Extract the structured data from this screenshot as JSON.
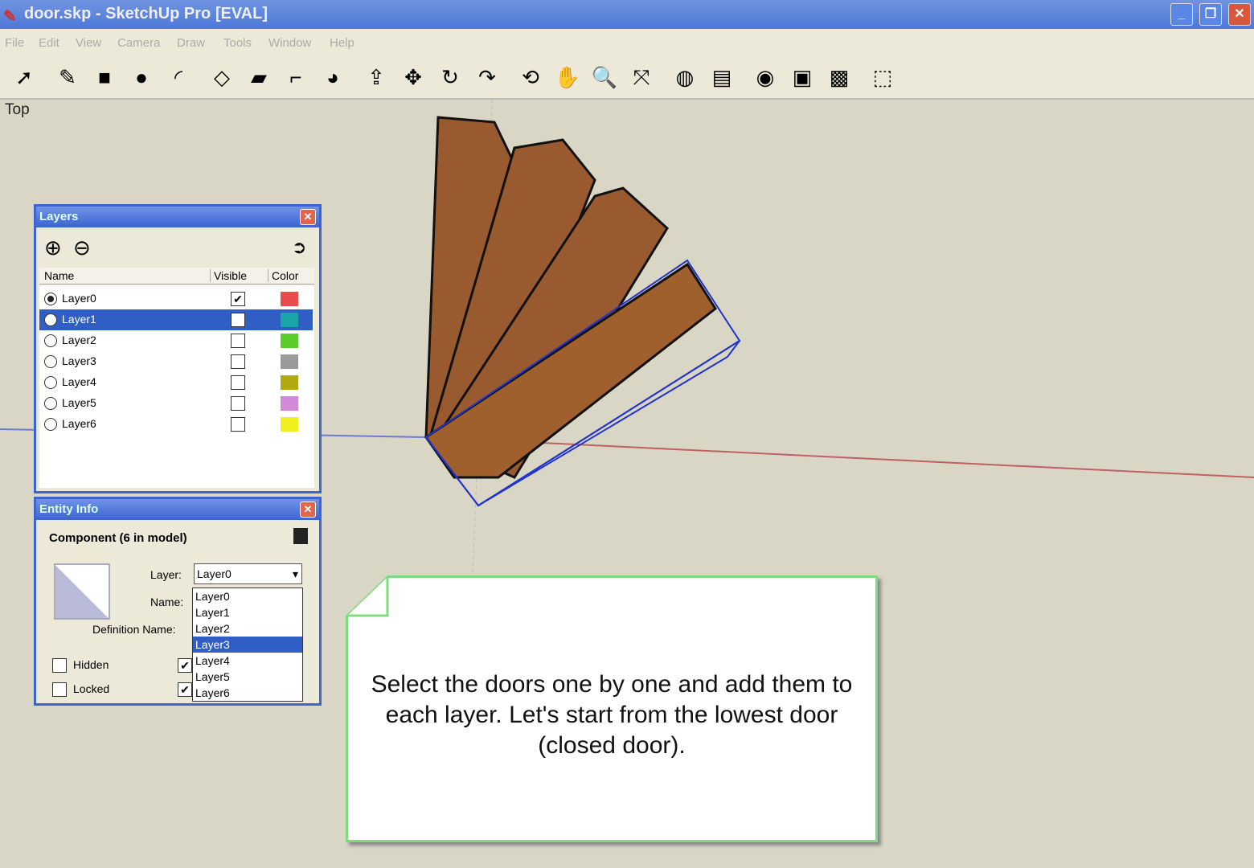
{
  "window": {
    "title": "door.skp - SketchUp Pro [EVAL]",
    "min": "_",
    "restore": "❐",
    "close": "✕"
  },
  "menu": [
    "File",
    "Edit",
    "View",
    "Camera",
    "Draw",
    "Tools",
    "Window",
    "Help"
  ],
  "toolbar": [
    {
      "name": "select",
      "g": "➚"
    },
    {
      "name": "pencil",
      "g": "✎"
    },
    {
      "name": "rectangle",
      "g": "■"
    },
    {
      "name": "circle",
      "g": "●"
    },
    {
      "name": "arc",
      "g": "◜"
    },
    {
      "name": "make-component",
      "g": "◇"
    },
    {
      "name": "eraser",
      "g": "▰"
    },
    {
      "name": "tape-measure",
      "g": "⌐"
    },
    {
      "name": "paint-bucket",
      "g": "◕"
    },
    {
      "name": "push-pull",
      "g": "⇪"
    },
    {
      "name": "move",
      "g": "✥"
    },
    {
      "name": "rotate",
      "g": "↻"
    },
    {
      "name": "follow-me",
      "g": "↷"
    },
    {
      "name": "orbit",
      "g": "⟲"
    },
    {
      "name": "pan",
      "g": "✋"
    },
    {
      "name": "zoom",
      "g": "🔍"
    },
    {
      "name": "zoom-extents",
      "g": "⤧"
    },
    {
      "name": "get-models",
      "g": "◍"
    },
    {
      "name": "share-model",
      "g": "▤"
    },
    {
      "name": "google-earth",
      "g": "◉"
    },
    {
      "name": "components",
      "g": "▣"
    },
    {
      "name": "share-component",
      "g": "▩"
    },
    {
      "name": "extension",
      "g": "⬚"
    }
  ],
  "view_label": "Top",
  "layers": {
    "title": "Layers",
    "close": "✕",
    "add": "⊕",
    "remove": "⊖",
    "details": "➲",
    "headers": {
      "name": "Name",
      "visible": "Visible",
      "color": "Color"
    },
    "rows": [
      {
        "name": "Layer0",
        "active": true,
        "visible": true,
        "color": "#e84c4c"
      },
      {
        "name": "Layer1",
        "active": false,
        "visible": false,
        "color": "#1aa6a6",
        "selected": true
      },
      {
        "name": "Layer2",
        "active": false,
        "visible": false,
        "color": "#5ccc2c"
      },
      {
        "name": "Layer3",
        "active": false,
        "visible": false,
        "color": "#9a9a9a"
      },
      {
        "name": "Layer4",
        "active": false,
        "visible": false,
        "color": "#b0aa10"
      },
      {
        "name": "Layer5",
        "active": false,
        "visible": false,
        "color": "#d28ad8"
      },
      {
        "name": "Layer6",
        "active": false,
        "visible": false,
        "color": "#f0f020"
      }
    ]
  },
  "entity": {
    "title": "Entity Info",
    "close": "✕",
    "heading": "Component (6 in model)",
    "layer_label": "Layer:",
    "layer_value": "Layer0",
    "name_label": "Name:",
    "defname_label": "Definition Name:",
    "hidden": "Hidden",
    "locked": "Locked",
    "options": [
      "Layer0",
      "Layer1",
      "Layer2",
      "Layer3",
      "Layer4",
      "Layer5",
      "Layer6"
    ],
    "highlighted": 3
  },
  "note": "Select the doors one by one and add them to each layer.  Let's start from the lowest door (closed door)."
}
